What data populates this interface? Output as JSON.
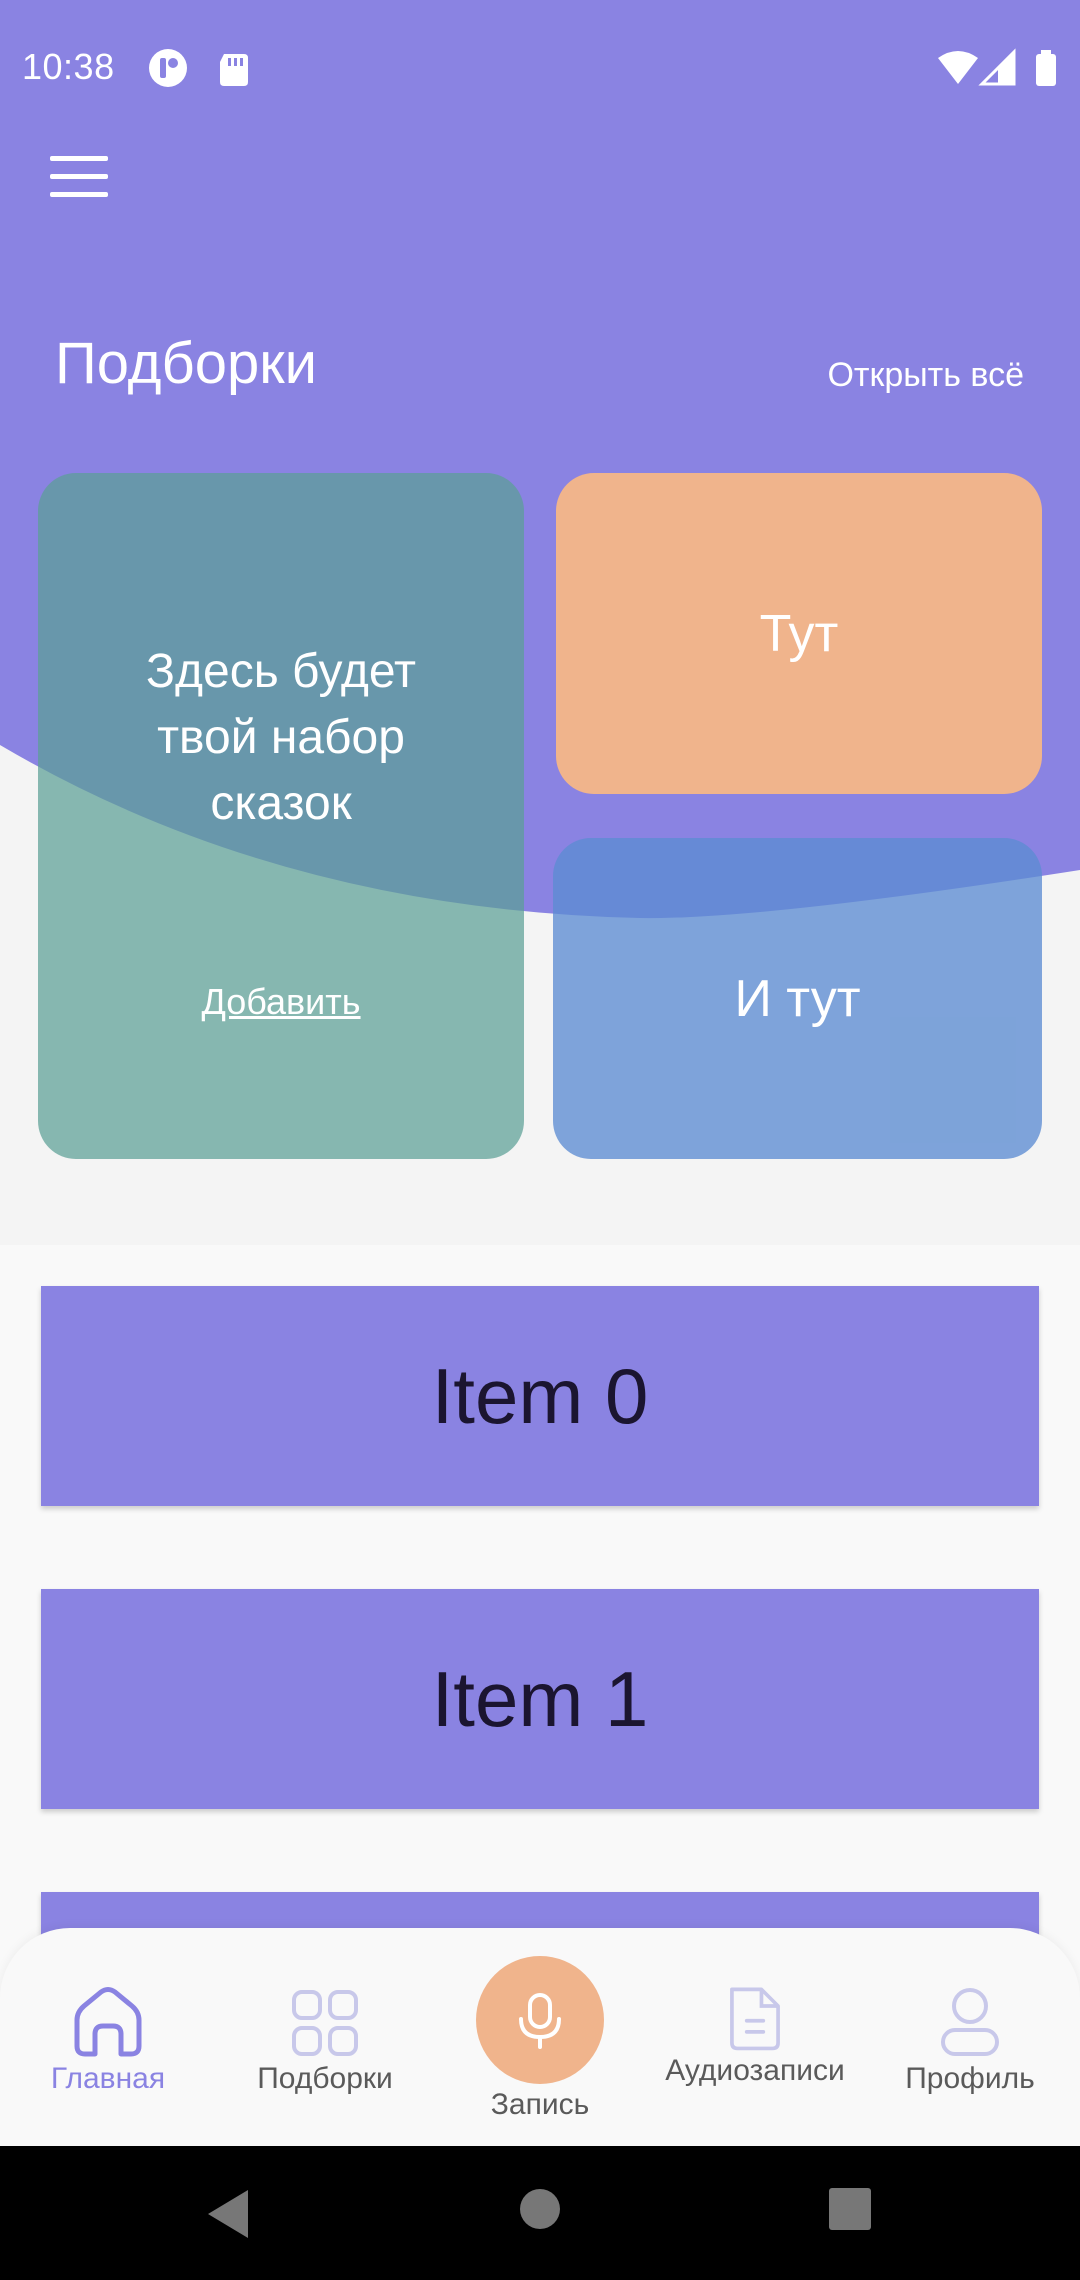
{
  "status_bar": {
    "time": "10:38"
  },
  "colors": {
    "hero": "#8a83e2",
    "accent_orange": "#f0b48c",
    "card_teal": "#5ca096",
    "card_blue": "#5c8cd2",
    "nav_active": "#8a83e2",
    "nav_inactive": "#c8c8ea"
  },
  "header": {
    "menu_icon": "hamburger-menu-icon"
  },
  "collections": {
    "title": "Подборки",
    "open_all": "Открыть всё",
    "main_card": {
      "text": "Здесь будет твой набор сказок",
      "add_link": "Добавить"
    },
    "card_here": "Тут",
    "card_and_here": "И тут"
  },
  "list": {
    "items": [
      "Item 0",
      "Item 1"
    ]
  },
  "bottom_nav": {
    "items": [
      {
        "label": "Главная",
        "icon": "home-icon",
        "active": true
      },
      {
        "label": "Подборки",
        "icon": "grid-icon",
        "active": false
      },
      {
        "label": "Запись",
        "icon": "microphone-icon",
        "active": false
      },
      {
        "label": "Аудиозаписи",
        "icon": "document-icon",
        "active": false
      },
      {
        "label": "Профиль",
        "icon": "profile-icon",
        "active": false
      }
    ]
  }
}
